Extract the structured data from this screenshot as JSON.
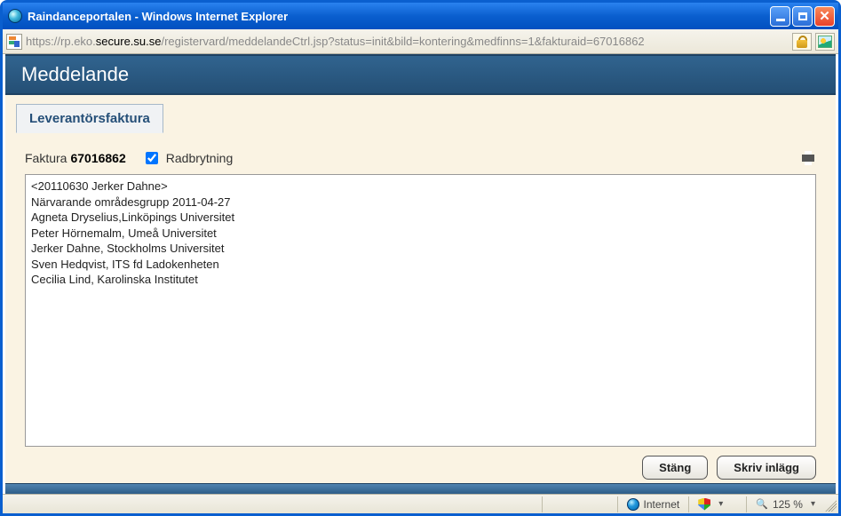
{
  "window": {
    "title": "Raindanceportalen - Windows Internet Explorer"
  },
  "address": {
    "scheme": "https://",
    "prefix": "rp.eko.",
    "host": "secure.su.se",
    "path": "/registervard/meddelandeCtrl.jsp?status=init&bild=kontering&medfinns=1&fakturaid=67016862"
  },
  "header": {
    "title": "Meddelande"
  },
  "tab": {
    "label": "Leverantörsfaktura"
  },
  "invoice": {
    "label": "Faktura",
    "number": "67016862"
  },
  "wrap": {
    "label": "Radbrytning",
    "checked": true
  },
  "message": {
    "text": "<20110630 Jerker Dahne>\nNärvarande områdesgrupp 2011-04-27\nAgneta Dryselius,Linköpings Universitet\nPeter Hörnemalm, Umeå Universitet\nJerker Dahne, Stockholms Universitet\nSven Hedqvist, ITS fd Ladokenheten\nCecilia Lind, Karolinska Institutet"
  },
  "buttons": {
    "close": "Stäng",
    "write": "Skriv inlägg"
  },
  "statusbar": {
    "zone": "Internet",
    "zoom": "125 %"
  }
}
